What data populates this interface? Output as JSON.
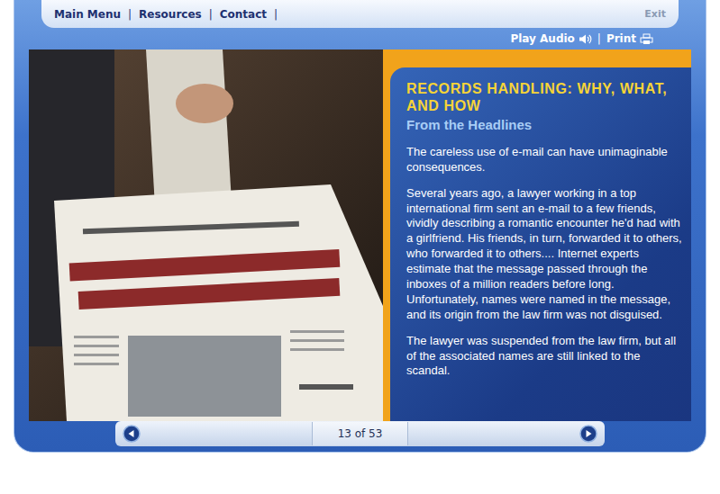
{
  "nav": {
    "items": [
      {
        "label": "Main Menu"
      },
      {
        "label": "Resources"
      },
      {
        "label": "Contact"
      }
    ],
    "separator": "|",
    "exit": "Exit"
  },
  "toolbar": {
    "play_audio": "Play Audio",
    "separator": "|",
    "print": "Print"
  },
  "panel": {
    "title": "RECORDS HANDLING: WHY, WHAT, AND HOW",
    "subtitle": "From the Headlines",
    "paragraphs": [
      "The careless use of e-mail can have unimaginable consequences.",
      "Several years ago, a lawyer working in a top international firm sent an e-mail to a few friends, vividly describing a romantic encounter he'd had with a girlfriend. His friends, in turn, forwarded it to others, who forwarded it to others.... Internet experts estimate that the message passed through the inboxes of a million readers before long. Unfortunately, names were named in the message, and its origin from the law firm was not disguised.",
      "The lawyer was suspended from the law firm, but all of the associated names are still linked to the scandal."
    ]
  },
  "pager": {
    "label": "13 of 53"
  }
}
